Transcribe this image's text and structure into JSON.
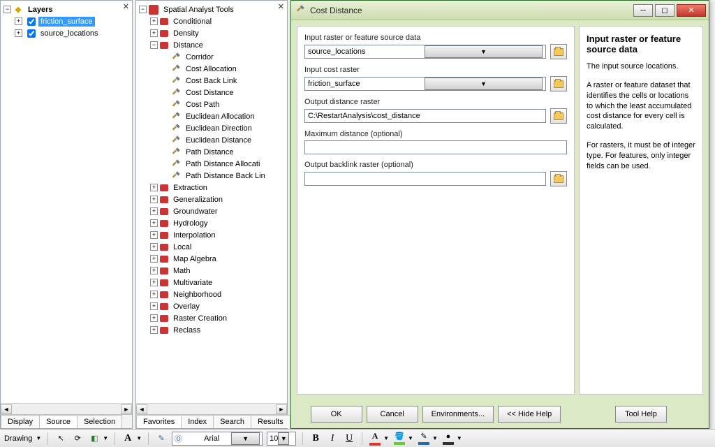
{
  "toc": {
    "root_label": "Layers",
    "root_expanded": true,
    "items": [
      {
        "label": "friction_surface",
        "checked": true,
        "selected": true
      },
      {
        "label": "source_locations",
        "checked": true,
        "selected": false
      }
    ],
    "tabs": [
      "Display",
      "Source",
      "Selection"
    ],
    "active_tab": 1
  },
  "toolbox": {
    "root_label": "Spatial Analyst Tools",
    "root_expanded": true,
    "toolsets": [
      {
        "label": "Conditional",
        "expanded": false
      },
      {
        "label": "Density",
        "expanded": false
      },
      {
        "label": "Distance",
        "expanded": true,
        "tools": [
          "Corridor",
          "Cost Allocation",
          "Cost Back Link",
          "Cost Distance",
          "Cost Path",
          "Euclidean Allocation",
          "Euclidean Direction",
          "Euclidean Distance",
          "Path Distance",
          "Path Distance Allocati",
          "Path Distance Back Lin"
        ]
      },
      {
        "label": "Extraction",
        "expanded": false
      },
      {
        "label": "Generalization",
        "expanded": false
      },
      {
        "label": "Groundwater",
        "expanded": false
      },
      {
        "label": "Hydrology",
        "expanded": false
      },
      {
        "label": "Interpolation",
        "expanded": false
      },
      {
        "label": "Local",
        "expanded": false
      },
      {
        "label": "Map Algebra",
        "expanded": false
      },
      {
        "label": "Math",
        "expanded": false
      },
      {
        "label": "Multivariate",
        "expanded": false
      },
      {
        "label": "Neighborhood",
        "expanded": false
      },
      {
        "label": "Overlay",
        "expanded": false
      },
      {
        "label": "Raster Creation",
        "expanded": false
      },
      {
        "label": "Reclass",
        "expanded": false
      }
    ],
    "tabs": [
      "Favorites",
      "Index",
      "Search",
      "Results"
    ],
    "active_tab": 0
  },
  "dialog": {
    "title": "Cost Distance",
    "fields": {
      "input_source_label": "Input raster or feature source data",
      "input_source_value": "source_locations",
      "input_cost_label": "Input cost raster",
      "input_cost_value": "friction_surface",
      "output_dist_label": "Output distance raster",
      "output_dist_value": "C:\\RestartAnalysis\\cost_distance",
      "max_dist_label": "Maximum distance (optional)",
      "max_dist_value": "",
      "backlink_label": "Output backlink raster (optional)",
      "backlink_value": ""
    },
    "buttons": {
      "ok": "OK",
      "cancel": "Cancel",
      "env": "Environments...",
      "hide": "<< Hide Help",
      "toolhelp": "Tool Help"
    },
    "help": {
      "heading": "Input raster or feature source data",
      "p1": "The input source locations.",
      "p2": "A raster or feature dataset that identifies the cells or locations to which the least accumulated cost distance for every cell is calculated.",
      "p3": "For rasters, it must be of integer type. For features, only integer fields can be used."
    }
  },
  "drawing_bar": {
    "label": "Drawing",
    "font_name": "Arial",
    "font_size": "10"
  }
}
